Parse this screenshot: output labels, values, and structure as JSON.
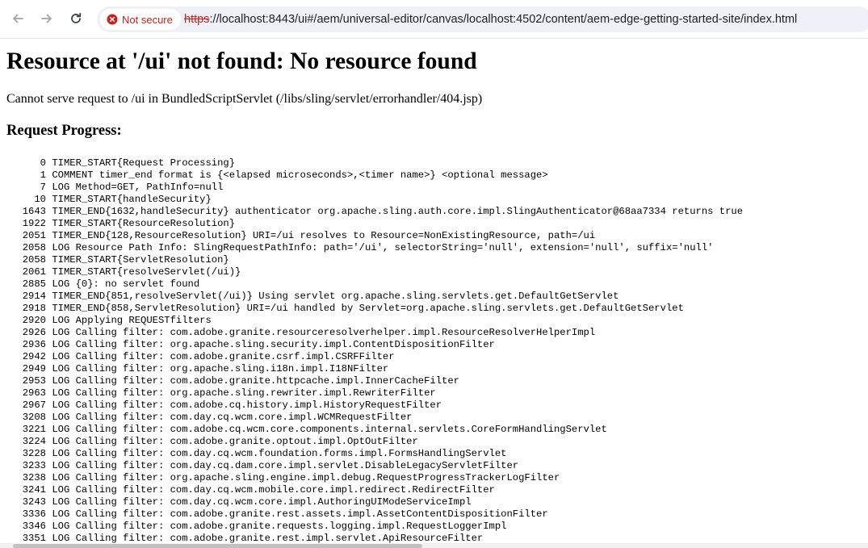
{
  "browser": {
    "back_icon": "arrow-left-icon",
    "forward_icon": "arrow-right-icon",
    "reload_icon": "reload-icon",
    "security_icon": "error-circle-icon",
    "security_label": "Not secure",
    "url_scheme": "https",
    "url_rest": "://localhost:8443/ui#/aem/universal-editor/canvas/localhost:4502/content/aem-edge-getting-started-site/index.html"
  },
  "page": {
    "title": "Resource at '/ui' not found: No resource found",
    "description": "Cannot serve request to /ui in BundledScriptServlet (/libs/sling/servlet/errorhandler/404.jsp)",
    "progress_heading": "Request Progress:",
    "log_lines": [
      {
        "t": "0",
        "msg": "TIMER_START{Request Processing}"
      },
      {
        "t": "1",
        "msg": "COMMENT timer_end format is {<elapsed microseconds>,<timer name>} <optional message>"
      },
      {
        "t": "7",
        "msg": "LOG Method=GET, PathInfo=null"
      },
      {
        "t": "10",
        "msg": "TIMER_START{handleSecurity}"
      },
      {
        "t": "1643",
        "msg": "TIMER_END{1632,handleSecurity} authenticator org.apache.sling.auth.core.impl.SlingAuthenticator@68aa7334 returns true"
      },
      {
        "t": "1922",
        "msg": "TIMER_START{ResourceResolution}"
      },
      {
        "t": "2051",
        "msg": "TIMER_END{128,ResourceResolution} URI=/ui resolves to Resource=NonExistingResource, path=/ui"
      },
      {
        "t": "2058",
        "msg": "LOG Resource Path Info: SlingRequestPathInfo: path='/ui', selectorString='null', extension='null', suffix='null'"
      },
      {
        "t": "2058",
        "msg": "TIMER_START{ServletResolution}"
      },
      {
        "t": "2061",
        "msg": "TIMER_START{resolveServlet(/ui)}"
      },
      {
        "t": "2885",
        "msg": "LOG {0}: no servlet found"
      },
      {
        "t": "2914",
        "msg": "TIMER_END{851,resolveServlet(/ui)} Using servlet org.apache.sling.servlets.get.DefaultGetServlet"
      },
      {
        "t": "2918",
        "msg": "TIMER_END{858,ServletResolution} URI=/ui handled by Servlet=org.apache.sling.servlets.get.DefaultGetServlet"
      },
      {
        "t": "2920",
        "msg": "LOG Applying REQUESTfilters"
      },
      {
        "t": "2926",
        "msg": "LOG Calling filter: com.adobe.granite.resourceresolverhelper.impl.ResourceResolverHelperImpl"
      },
      {
        "t": "2936",
        "msg": "LOG Calling filter: org.apache.sling.security.impl.ContentDispositionFilter"
      },
      {
        "t": "2942",
        "msg": "LOG Calling filter: com.adobe.granite.csrf.impl.CSRFFilter"
      },
      {
        "t": "2949",
        "msg": "LOG Calling filter: org.apache.sling.i18n.impl.I18NFilter"
      },
      {
        "t": "2953",
        "msg": "LOG Calling filter: com.adobe.granite.httpcache.impl.InnerCacheFilter"
      },
      {
        "t": "2963",
        "msg": "LOG Calling filter: org.apache.sling.rewriter.impl.RewriterFilter"
      },
      {
        "t": "2967",
        "msg": "LOG Calling filter: com.adobe.cq.history.impl.HistoryRequestFilter"
      },
      {
        "t": "3208",
        "msg": "LOG Calling filter: com.day.cq.wcm.core.impl.WCMRequestFilter"
      },
      {
        "t": "3221",
        "msg": "LOG Calling filter: com.adobe.cq.wcm.core.components.internal.servlets.CoreFormHandlingServlet"
      },
      {
        "t": "3224",
        "msg": "LOG Calling filter: com.adobe.granite.optout.impl.OptOutFilter"
      },
      {
        "t": "3228",
        "msg": "LOG Calling filter: com.day.cq.wcm.foundation.forms.impl.FormsHandlingServlet"
      },
      {
        "t": "3233",
        "msg": "LOG Calling filter: com.day.cq.dam.core.impl.servlet.DisableLegacyServletFilter"
      },
      {
        "t": "3238",
        "msg": "LOG Calling filter: org.apache.sling.engine.impl.debug.RequestProgressTrackerLogFilter"
      },
      {
        "t": "3241",
        "msg": "LOG Calling filter: com.day.cq.wcm.mobile.core.impl.redirect.RedirectFilter"
      },
      {
        "t": "3243",
        "msg": "LOG Calling filter: com.day.cq.wcm.core.impl.AuthoringUIModeServiceImpl"
      },
      {
        "t": "3336",
        "msg": "LOG Calling filter: com.adobe.granite.rest.assets.impl.AssetContentDispositionFilter"
      },
      {
        "t": "3346",
        "msg": "LOG Calling filter: com.adobe.granite.requests.logging.impl.RequestLoggerImpl"
      },
      {
        "t": "3351",
        "msg": "LOG Calling filter: com.adobe.granite.rest.impl.servlet.ApiResourceFilter"
      }
    ]
  }
}
